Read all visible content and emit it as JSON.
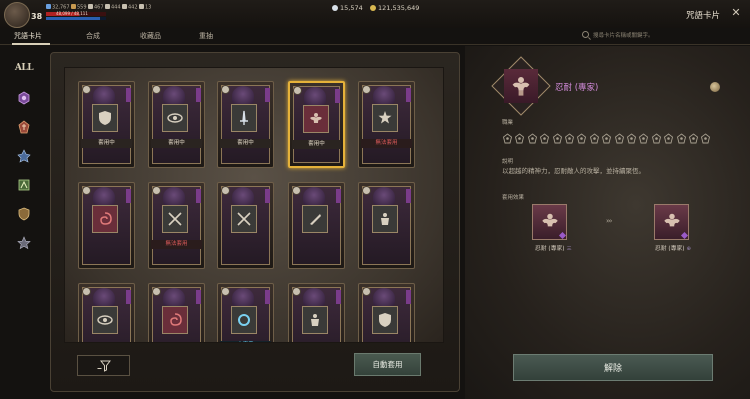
{
  "player": {
    "level": "38"
  },
  "stats": [
    {
      "icon": "attack-icon",
      "value": "32,767",
      "color": "#6aa0e0"
    },
    {
      "icon": "defense-icon",
      "value": "559",
      "color": "#c89a50"
    },
    {
      "icon": "critical-icon",
      "value": "467",
      "color": "#c8c0b0"
    },
    {
      "icon": "speed-icon",
      "value": "444",
      "color": "#c8c0b0"
    },
    {
      "icon": "accuracy-icon",
      "value": "442",
      "color": "#c8c0b0"
    },
    {
      "icon": "weight-icon",
      "value": "13",
      "color": "#c8c0b0"
    }
  ],
  "hp": {
    "fill": 0.55,
    "text": "48,099 / 48,111"
  },
  "mp": {
    "fill": 0.9
  },
  "currencies": [
    {
      "icon": "diamond-icon",
      "value": "15,574",
      "color": "#d8e0e8"
    },
    {
      "icon": "gold-coin-icon",
      "value": "121,535,649",
      "color": "#d8b850"
    }
  ],
  "window": {
    "title": "咒語卡片",
    "close": "✕"
  },
  "tabs": [
    "咒語卡片",
    "合成",
    "收藏品",
    "重抽"
  ],
  "search": {
    "placeholder": "搜尋卡片名稱或關鍵字。"
  },
  "filters": {
    "all_label": "ALL"
  },
  "status_labels": {
    "equipped": "套用中",
    "unavailable": "無法套用",
    "unequipped": "未穿戴"
  },
  "cards": [
    {
      "emblem": "shield-icon",
      "status": "equipped"
    },
    {
      "emblem": "eye-icon",
      "status": "equipped"
    },
    {
      "emblem": "sword-icon",
      "status": "equipped"
    },
    {
      "emblem": "muscle-icon",
      "status": "equipped",
      "selected": true
    },
    {
      "emblem": "star-icon",
      "status": "unavailable"
    },
    {
      "emblem": "swirl-icon",
      "status": ""
    },
    {
      "emblem": "crossed-swords-icon",
      "status": "unavailable"
    },
    {
      "emblem": "crossed-swords-icon",
      "status": ""
    },
    {
      "emblem": "blade-icon",
      "status": ""
    },
    {
      "emblem": "warrior-icon",
      "status": ""
    },
    {
      "emblem": "eye-icon",
      "status": ""
    },
    {
      "emblem": "swirl-icon",
      "status": ""
    },
    {
      "emblem": "ring-icon",
      "status": "unequipped"
    },
    {
      "emblem": "warrior-icon",
      "status": ""
    },
    {
      "emblem": "shield-icon",
      "status": ""
    }
  ],
  "buttons": {
    "auto_equip": "自動套用",
    "release": "解除"
  },
  "detail": {
    "card_name": "忍耐 (專家)",
    "class_label": "職業",
    "class_icons": [
      "class-1-icon",
      "class-2-icon",
      "class-3-icon",
      "class-4-icon",
      "class-5-icon",
      "class-6-icon",
      "class-7-icon",
      "class-8-icon",
      "class-9-icon",
      "class-10-icon",
      "class-11-icon",
      "class-12-icon",
      "class-13-icon",
      "class-14-icon",
      "class-15-icon",
      "class-16-icon",
      "class-17-icon"
    ],
    "description_label": "說明",
    "description": "以超越的精神力，忍耐敵人的攻擊，並持續聚恆。",
    "effect_label": "套用效果",
    "effect_from": {
      "name": "忍耐 (專家)",
      "sub": "三"
    },
    "effect_to": {
      "name": "忍耐 (專家)",
      "sub": "⊕"
    },
    "arrow": "›››"
  },
  "colors": {
    "selected_border": "#e5b23a",
    "card_name": "#d08ad8",
    "unavailable": "#e05c5c",
    "unequipped": "#6ed0f0"
  }
}
